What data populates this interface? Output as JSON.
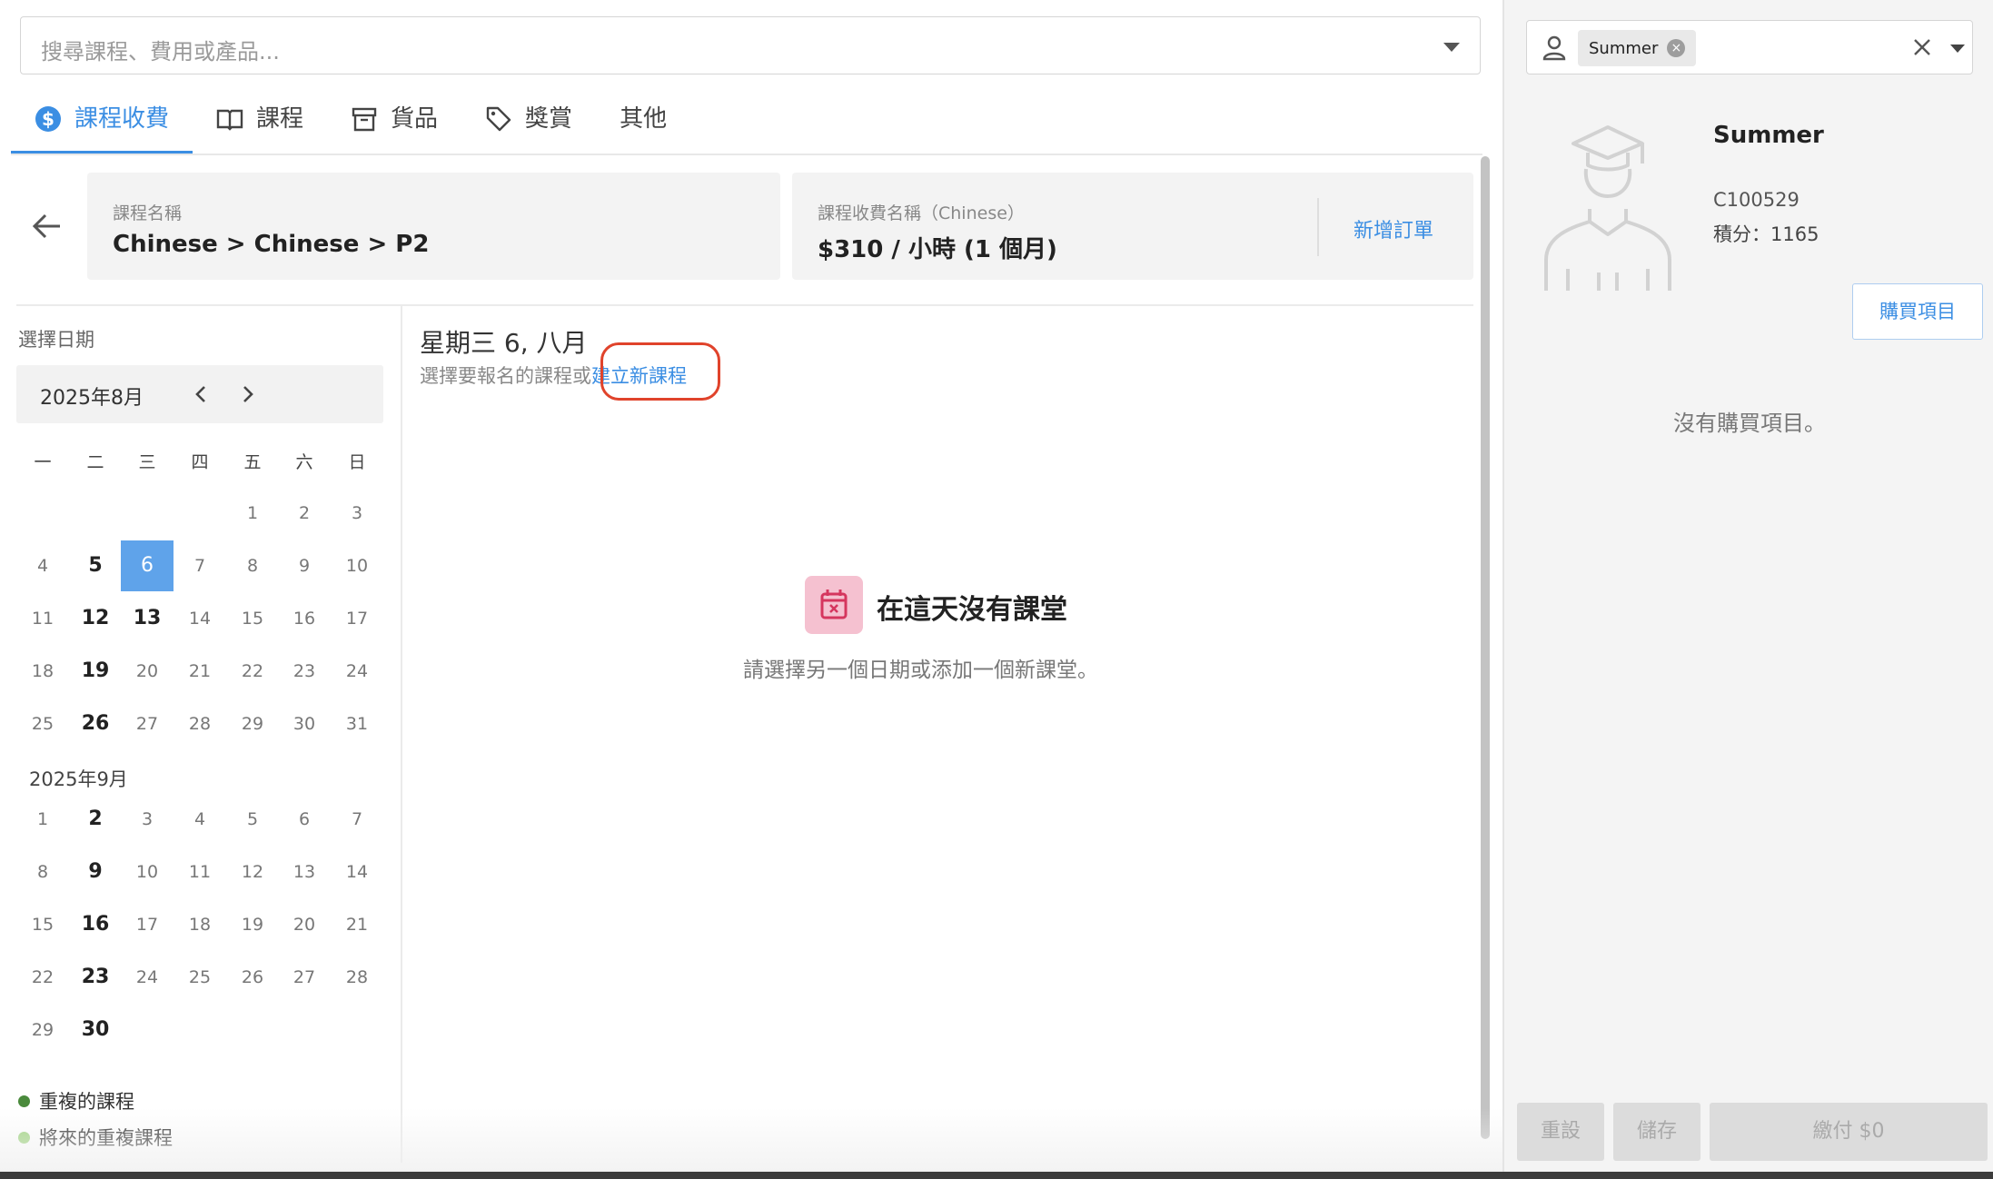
{
  "search": {
    "placeholder": "搜尋課程、費用或產品..."
  },
  "tabs": [
    {
      "label": "課程收費",
      "icon": "dollar-icon",
      "active": true
    },
    {
      "label": "課程",
      "icon": "book-icon",
      "active": false
    },
    {
      "label": "貨品",
      "icon": "archive-icon",
      "active": false
    },
    {
      "label": "獎賞",
      "icon": "tag-icon",
      "active": false
    },
    {
      "label": "其他",
      "icon": "",
      "active": false
    }
  ],
  "course": {
    "name_label": "課程名稱",
    "name_value": "Chinese > Chinese > P2",
    "fee_label": "課程收費名稱（Chinese）",
    "fee_value": "$310 / 小時 (1 個月)",
    "add_order": "新增訂單"
  },
  "calendar": {
    "title": "選擇日期",
    "month1": "2025年8月",
    "month2": "2025年9月",
    "weekdays": [
      "一",
      "二",
      "三",
      "四",
      "五",
      "六",
      "日"
    ],
    "selected_day": 6,
    "august_bold_days": [
      5,
      12,
      13,
      19,
      26
    ],
    "september_bold_days": [
      2,
      9,
      16,
      23,
      30
    ]
  },
  "legend": [
    {
      "label": "重複的課程",
      "color": "#4a8a3c"
    },
    {
      "label": "將來的重複課程",
      "color": "#9ed37f"
    }
  ],
  "schedule": {
    "date_heading": "星期三 6, 八月",
    "choose_text": "選擇要報名的課程或",
    "create_link": "建立新課程",
    "empty_title": "在這天沒有課堂",
    "empty_sub": "請選擇另一個日期或添加一個新課堂。"
  },
  "customer": {
    "chip": "Summer",
    "name": "Summer",
    "id": "C100529",
    "points": "積分：1165",
    "buy_button": "購買項目",
    "no_items": "沒有購買項目。"
  },
  "footer": {
    "reset": "重設",
    "save": "儲存",
    "pay": "繳付 $0"
  },
  "colors": {
    "accent": "#3b8ee3",
    "selected_day": "#5fa3ea",
    "highlight_circle": "#e0432b",
    "empty_icon_bg": "#f5c1d0"
  }
}
